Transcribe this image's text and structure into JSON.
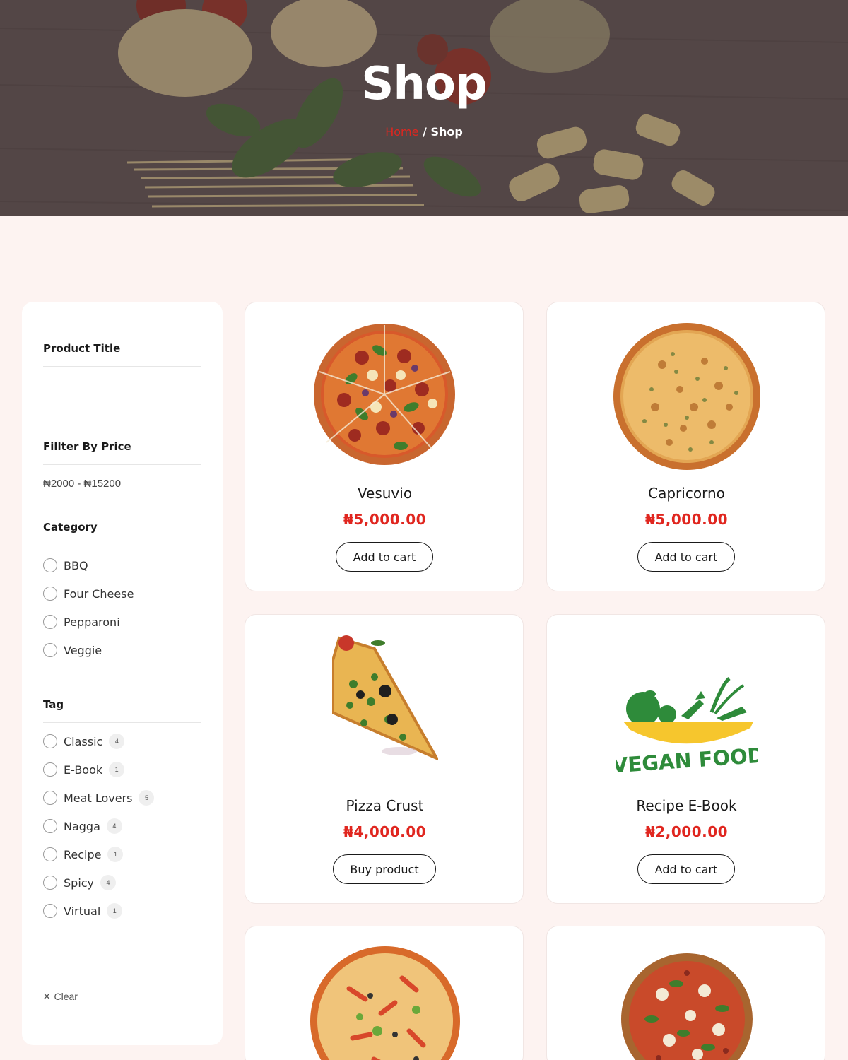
{
  "hero": {
    "title": "Shop",
    "breadcrumb_home": "Home",
    "breadcrumb_separator": "/",
    "breadcrumb_current": "Shop"
  },
  "sidebar": {
    "product_title_heading": "Product Title",
    "price_heading": "Fillter By Price",
    "price_range": "₦2000 - ₦15200",
    "category_heading": "Category",
    "categories": [
      {
        "label": "BBQ"
      },
      {
        "label": "Four Cheese"
      },
      {
        "label": "Pepparoni"
      },
      {
        "label": "Veggie"
      }
    ],
    "tag_heading": "Tag",
    "tags": [
      {
        "label": "Classic",
        "count": "4"
      },
      {
        "label": "E-Book",
        "count": "1"
      },
      {
        "label": "Meat Lovers",
        "count": "5"
      },
      {
        "label": "Nagga",
        "count": "4"
      },
      {
        "label": "Recipe",
        "count": "1"
      },
      {
        "label": "Spicy",
        "count": "4"
      },
      {
        "label": "Virtual",
        "count": "1"
      }
    ],
    "clear_label": "Clear"
  },
  "products": [
    {
      "name": "Vesuvio",
      "price": "₦5,000.00",
      "button": "Add to cart",
      "image": "pizza-vesuvio"
    },
    {
      "name": "Capricorno",
      "price": "₦5,000.00",
      "button": "Add to cart",
      "image": "pizza-capricorno"
    },
    {
      "name": "Pizza Crust",
      "price": "₦4,000.00",
      "button": "Buy product",
      "image": "pizza-slice"
    },
    {
      "name": "Recipe E-Book",
      "price": "₦2,000.00",
      "button": "Add to cart",
      "image": "vegan-food-logo"
    },
    {
      "name": "",
      "price": "",
      "button": "",
      "image": "pizza-sausage"
    },
    {
      "name": "",
      "price": "",
      "button": "",
      "image": "pizza-margherita"
    }
  ],
  "logo_text": "VEGAN FOOD",
  "colors": {
    "accent": "#e0261f",
    "page_bg": "#fdf3f1",
    "card_bg": "#ffffff",
    "vegan_green": "#2e8b3a",
    "vegan_yellow": "#f6c62d"
  }
}
